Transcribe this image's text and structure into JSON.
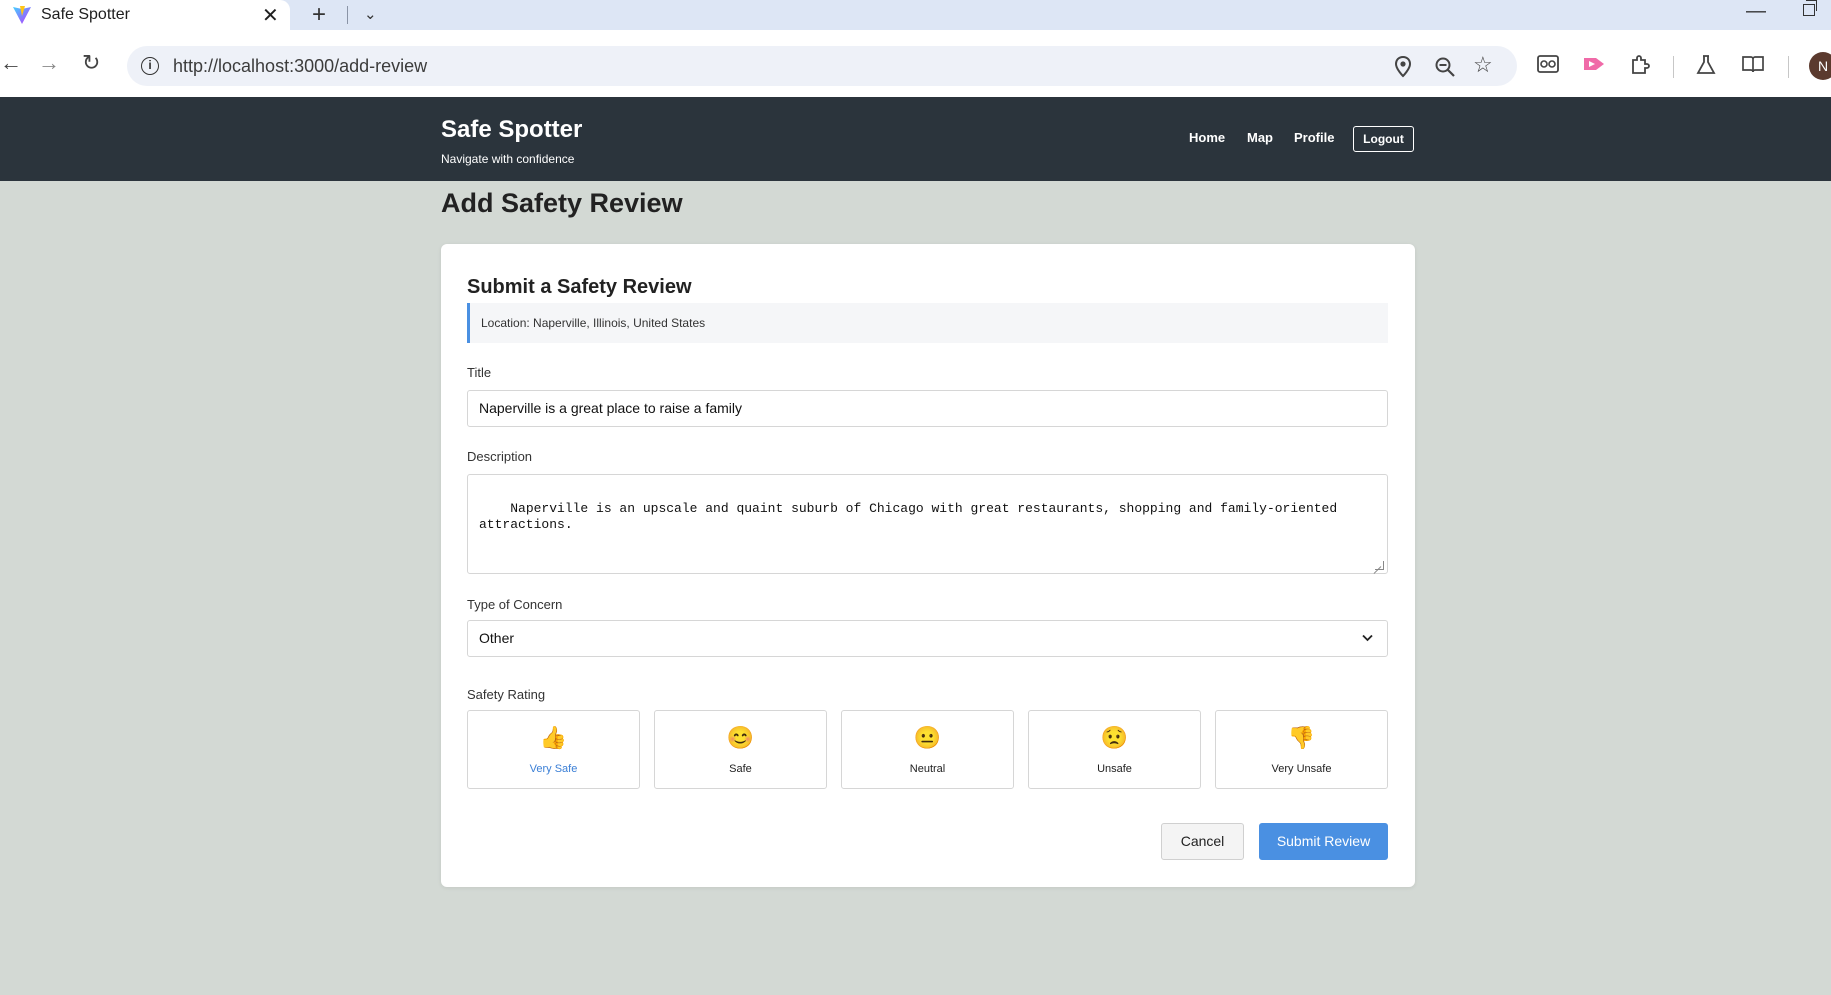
{
  "browser": {
    "tab_title": "Safe Spotter",
    "url": "http://localhost:3000/add-review",
    "avatar_initial": "N"
  },
  "header": {
    "brand": "Safe Spotter",
    "tagline": "Navigate with confidence",
    "nav": [
      "Home",
      "Map",
      "Profile"
    ],
    "logout_label": "Logout"
  },
  "page": {
    "title": "Add Safety Review"
  },
  "form": {
    "heading": "Submit a Safety Review",
    "location": "Location: Naperville, Illinois, United States",
    "title_label": "Title",
    "title_value": "Naperville is a great place to raise a family",
    "description_label": "Description",
    "description_value": "Naperville is an upscale and quaint suburb of Chicago with great restaurants, shopping and family-oriented attractions.",
    "concern_label": "Type of Concern",
    "concern_value": "Other",
    "rating_label": "Safety Rating",
    "ratings": [
      {
        "emoji": "👍",
        "label": "Very Safe",
        "selected": true
      },
      {
        "emoji": "😊",
        "label": "Safe",
        "selected": false
      },
      {
        "emoji": "😐",
        "label": "Neutral",
        "selected": false
      },
      {
        "emoji": "😟",
        "label": "Unsafe",
        "selected": false
      },
      {
        "emoji": "👎",
        "label": "Very Unsafe",
        "selected": false
      }
    ],
    "cancel_label": "Cancel",
    "submit_label": "Submit Review"
  },
  "colors": {
    "header_bg": "#2b343c",
    "page_bg": "#d3d9d4",
    "accent": "#4a90e2"
  }
}
